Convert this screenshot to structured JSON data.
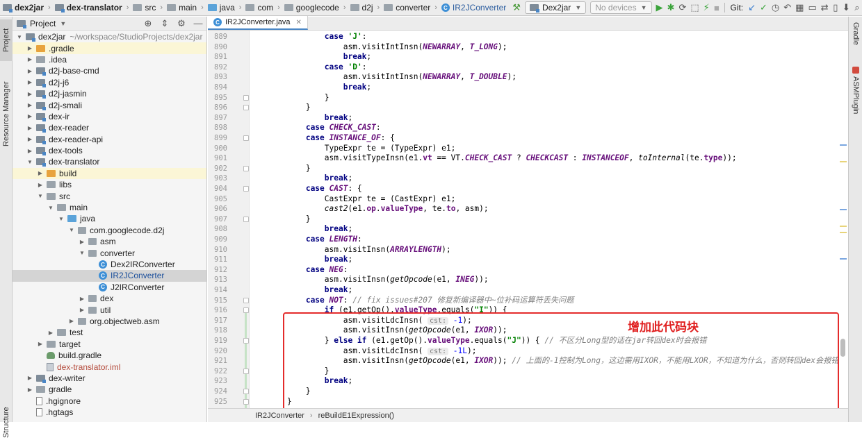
{
  "breadcrumbs": [
    "dex2jar",
    "dex-translator",
    "src",
    "main",
    "java",
    "com",
    "googlecode",
    "d2j",
    "converter",
    "IR2JConverter"
  ],
  "toolbar": {
    "run_config": "Dex2jar",
    "device": "No devices",
    "git_label": "Git:"
  },
  "left_tabs": {
    "project": "Project",
    "resource_manager": "Resource Manager",
    "structure": "Structure"
  },
  "right_tabs": {
    "gradle": "Gradle",
    "asm_plugin": "ASMPlugin"
  },
  "project_panel": {
    "title": "Project",
    "tree": [
      {
        "label": "dex2jar",
        "hint": "~/workspace/StudioProjects/dex2jar",
        "indent": 0,
        "open": true,
        "icon": "module"
      },
      {
        "label": ".gradle",
        "indent": 1,
        "icon": "folder-orange",
        "hl": true
      },
      {
        "label": ".idea",
        "indent": 1,
        "icon": "folder"
      },
      {
        "label": "d2j-base-cmd",
        "indent": 1,
        "icon": "module"
      },
      {
        "label": "d2j-j6",
        "indent": 1,
        "icon": "module"
      },
      {
        "label": "d2j-jasmin",
        "indent": 1,
        "icon": "module"
      },
      {
        "label": "d2j-smali",
        "indent": 1,
        "icon": "module"
      },
      {
        "label": "dex-ir",
        "indent": 1,
        "icon": "module"
      },
      {
        "label": "dex-reader",
        "indent": 1,
        "icon": "module"
      },
      {
        "label": "dex-reader-api",
        "indent": 1,
        "icon": "module"
      },
      {
        "label": "dex-tools",
        "indent": 1,
        "icon": "module"
      },
      {
        "label": "dex-translator",
        "indent": 1,
        "icon": "module",
        "open": true
      },
      {
        "label": "build",
        "indent": 2,
        "icon": "folder-orange",
        "hl": true
      },
      {
        "label": "libs",
        "indent": 2,
        "icon": "folder"
      },
      {
        "label": "src",
        "indent": 2,
        "icon": "folder",
        "open": true
      },
      {
        "label": "main",
        "indent": 3,
        "icon": "folder",
        "open": true
      },
      {
        "label": "java",
        "indent": 4,
        "icon": "folder-blue",
        "open": true
      },
      {
        "label": "com.googlecode.d2j",
        "indent": 5,
        "icon": "package",
        "open": true
      },
      {
        "label": "asm",
        "indent": 6,
        "icon": "package"
      },
      {
        "label": "converter",
        "indent": 6,
        "icon": "package",
        "open": true
      },
      {
        "label": "Dex2IRConverter",
        "indent": 7,
        "icon": "class",
        "leaf": true
      },
      {
        "label": "IR2JConverter",
        "indent": 7,
        "icon": "class",
        "leaf": true,
        "selected": true
      },
      {
        "label": "J2IRConverter",
        "indent": 7,
        "icon": "class",
        "leaf": true
      },
      {
        "label": "dex",
        "indent": 6,
        "icon": "package"
      },
      {
        "label": "util",
        "indent": 6,
        "icon": "package"
      },
      {
        "label": "org.objectweb.asm",
        "indent": 5,
        "icon": "package"
      },
      {
        "label": "test",
        "indent": 3,
        "icon": "folder"
      },
      {
        "label": "target",
        "indent": 2,
        "icon": "folder"
      },
      {
        "label": "build.gradle",
        "indent": 2,
        "icon": "gradle",
        "leaf": true
      },
      {
        "label": "dex-translator.iml",
        "indent": 2,
        "icon": "iml",
        "leaf": true,
        "red": true
      },
      {
        "label": "dex-writer",
        "indent": 1,
        "icon": "module"
      },
      {
        "label": "gradle",
        "indent": 1,
        "icon": "folder"
      },
      {
        "label": ".hgignore",
        "indent": 1,
        "icon": "file",
        "leaf": true
      },
      {
        "label": ".hgtags",
        "indent": 1,
        "icon": "file",
        "leaf": true
      }
    ]
  },
  "editor": {
    "tab": "IR2JConverter.java",
    "annotation": "增加此代码块",
    "status_path": [
      "IR2JConverter",
      "reBuildE1Expression()"
    ],
    "lines": [
      {
        "n": "889",
        "h": "                <span class=\"kw\">case</span> <span class=\"str\">'J'</span>:"
      },
      {
        "n": "890",
        "h": "                    asm.visitIntInsn(<span class=\"cn\">NEWARRAY</span>, <span class=\"cn\">T_LONG</span>);"
      },
      {
        "n": "891",
        "h": "                    <span class=\"kw\">break</span>;"
      },
      {
        "n": "892",
        "h": "                <span class=\"kw\">case</span> <span class=\"str\">'D'</span>:"
      },
      {
        "n": "893",
        "h": "                    asm.visitIntInsn(<span class=\"cn\">NEWARRAY</span>, <span class=\"cn\">T_DOUBLE</span>);"
      },
      {
        "n": "894",
        "h": "                    <span class=\"kw\">break</span>;"
      },
      {
        "n": "895",
        "h": "                }"
      },
      {
        "n": "896",
        "h": "            }"
      },
      {
        "n": "897",
        "h": "                <span class=\"kw\">break</span>;"
      },
      {
        "n": "898",
        "h": "            <span class=\"kw\">case</span> <span class=\"cn\">CHECK_CAST</span>:"
      },
      {
        "n": "899",
        "h": "            <span class=\"kw\">case</span> <span class=\"cn\">INSTANCE_OF</span>: {"
      },
      {
        "n": "900",
        "h": "                TypeExpr te = (TypeExpr) e1;"
      },
      {
        "n": "901",
        "h": "                asm.visitTypeInsn(e1.<span class=\"fld\">vt</span> == VT.<span class=\"cn\">CHECK_CAST</span> ? <span class=\"cn\">CHECKCAST</span> : <span class=\"cn\">INSTANCEOF</span>, <span class=\"it\">toInternal</span>(te.<span class=\"fld\">type</span>));"
      },
      {
        "n": "902",
        "h": "            }"
      },
      {
        "n": "903",
        "h": "                <span class=\"kw\">break</span>;"
      },
      {
        "n": "904",
        "h": "            <span class=\"kw\">case</span> <span class=\"cn\">CAST</span>: {"
      },
      {
        "n": "905",
        "h": "                CastExpr te = (CastExpr) e1;"
      },
      {
        "n": "906",
        "h": "                <span class=\"it\">cast2</span>(e1.<span class=\"fld\">op</span>.<span class=\"fld\">valueType</span>, te.<span class=\"fld\">to</span>, asm);"
      },
      {
        "n": "907",
        "h": "            }"
      },
      {
        "n": "908",
        "h": "                <span class=\"kw\">break</span>;"
      },
      {
        "n": "909",
        "h": "            <span class=\"kw\">case</span> <span class=\"cn\">LENGTH</span>:"
      },
      {
        "n": "910",
        "h": "                asm.visitInsn(<span class=\"cn\">ARRAYLENGTH</span>);"
      },
      {
        "n": "911",
        "h": "                <span class=\"kw\">break</span>;"
      },
      {
        "n": "912",
        "h": "            <span class=\"kw\">case</span> <span class=\"cn\">NEG</span>:"
      },
      {
        "n": "913",
        "h": "                asm.visitInsn(<span class=\"it\">getOpcode</span>(e1, <span class=\"cn\">INEG</span>));"
      },
      {
        "n": "914",
        "h": "                <span class=\"kw\">break</span>;"
      },
      {
        "n": "915",
        "h": "            <span class=\"kw\">case</span> <span class=\"cn\">NOT</span>: <span class=\"cmt\">// fix issues#207 修复新编译器中~位补码运算符丢失问题</span>"
      },
      {
        "n": "916",
        "h": "                <span class=\"kw\">if</span> (e1.getOp().<span class=\"fld\">valueType</span>.equals(<span class=\"str\">\"I\"</span>)) {"
      },
      {
        "n": "917",
        "h": "                    asm.visitLdcInsn( <span class=\"hint\">cst:</span> <span class=\"num\">-1</span>);"
      },
      {
        "n": "918",
        "h": "                    asm.visitInsn(<span class=\"it\">getOpcode</span>(e1, <span class=\"cn\">IXOR</span>));"
      },
      {
        "n": "919",
        "h": "                } <span class=\"kw\">else if</span> (e1.getOp().<span class=\"fld\">valueType</span>.equals(<span class=\"str\">\"J\"</span>)) { <span class=\"cmt\">// 不区分Long型的话在jar转回dex时会报错</span>"
      },
      {
        "n": "920",
        "h": "                    asm.visitLdcInsn( <span class=\"hint\">cst:</span> <span class=\"num\">-1L</span>);"
      },
      {
        "n": "921",
        "h": "                    asm.visitInsn(<span class=\"it\">getOpcode</span>(e1, <span class=\"cn\">IXOR</span>)); <span class=\"cmt\">// 上面的-1控制为Long，这边需用IXOR，不能用LXOR，不知道为什么，否则转回dex会报错</span>"
      },
      {
        "n": "922",
        "h": "                }"
      },
      {
        "n": "923",
        "h": "                <span class=\"kw\">break</span>;"
      },
      {
        "n": "924",
        "h": "            }"
      },
      {
        "n": "925",
        "h": "        }"
      }
    ]
  }
}
